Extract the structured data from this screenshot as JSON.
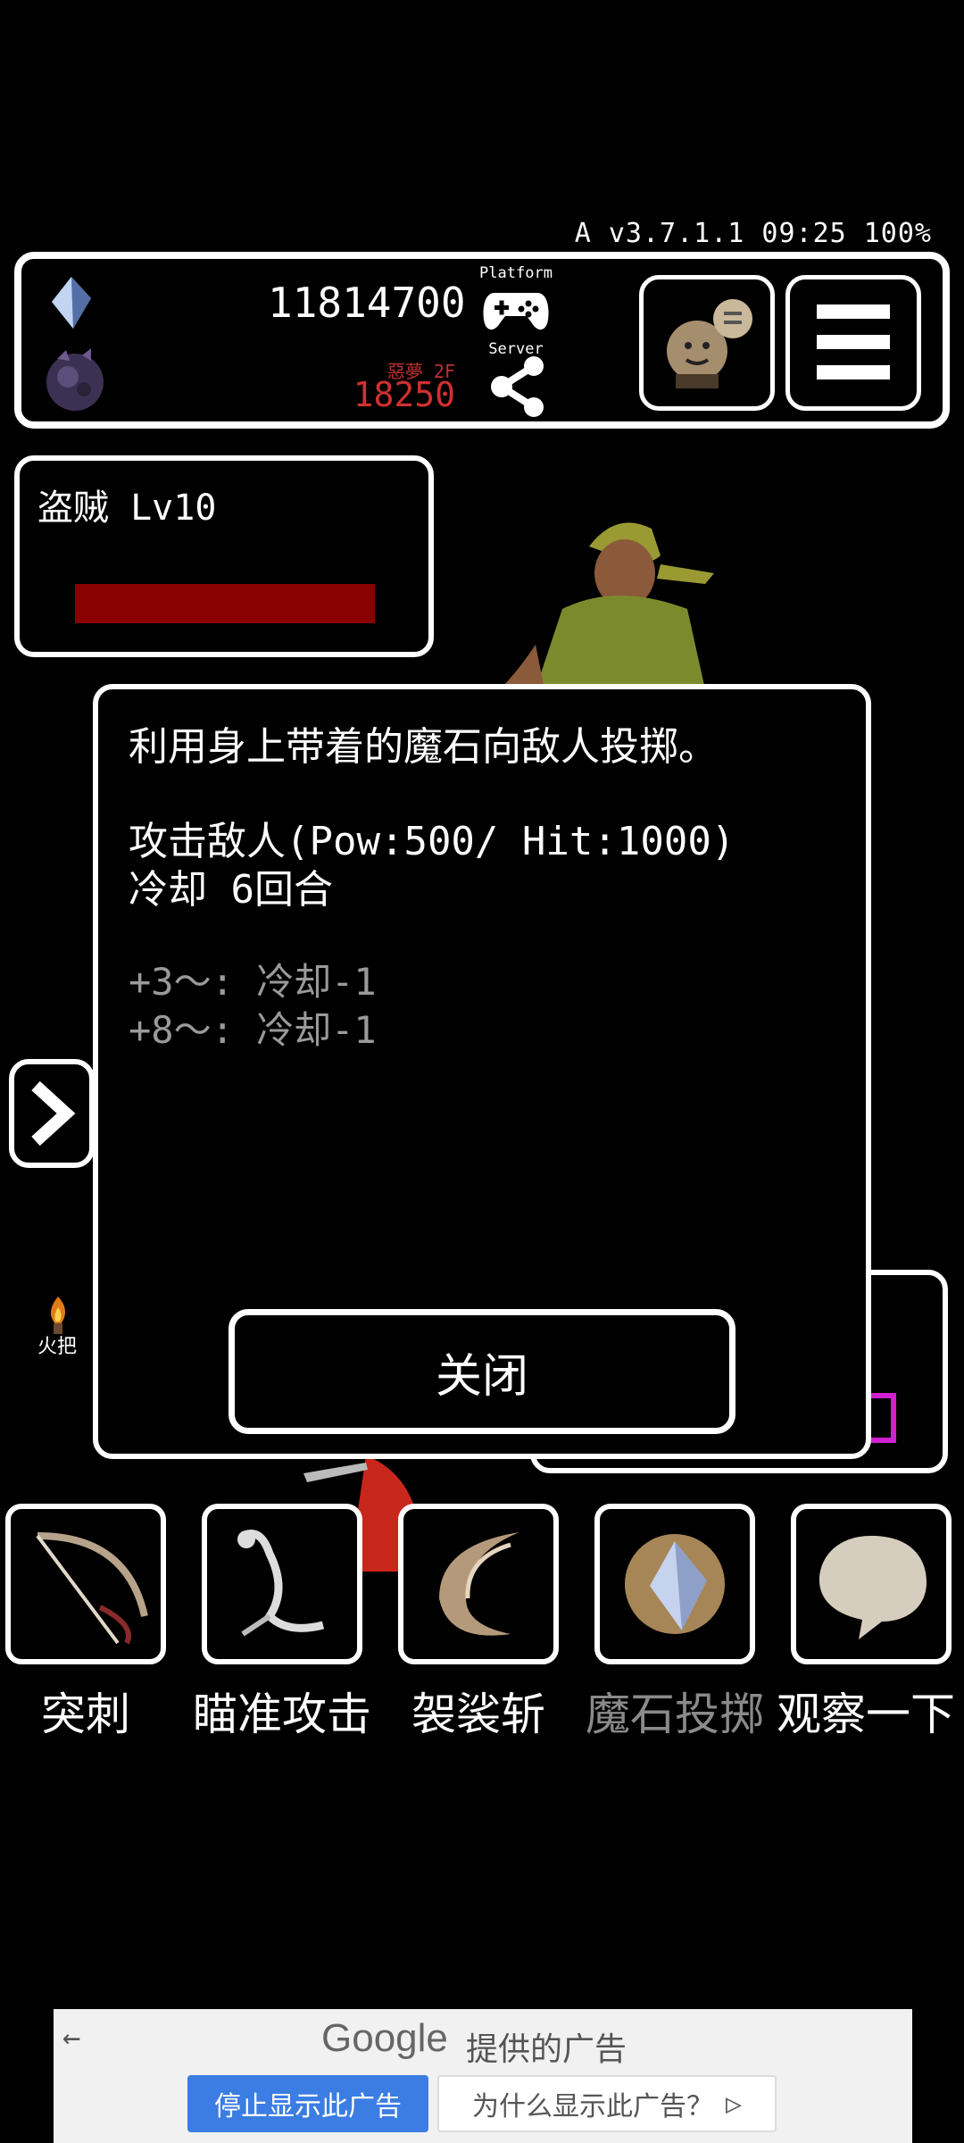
{
  "status": {
    "text": "A v3.7.1.1 09:25 100%"
  },
  "topbar": {
    "gold": "11814700",
    "floor": "惡夢 2F",
    "points": "18250",
    "platform_label": "Platform",
    "server_label": "Server"
  },
  "enemy": {
    "name": "盗贼 Lv10",
    "hp_fraction": 1.0
  },
  "dialog": {
    "description": "利用身上带着的魔石向敌人投掷。",
    "attack": "攻击敌人(Pow:500/ Hit:1000)",
    "cooldown": "冷却 6回合",
    "bonus1": "+3～: 冷却-1",
    "bonus2": "+8～: 冷却-1",
    "close_label": "关闭"
  },
  "side": {
    "torch_label": "火把"
  },
  "skills": [
    {
      "label": "突刺",
      "icon": "bow-icon",
      "enabled": true
    },
    {
      "label": "瞄准攻击",
      "icon": "scorpion-icon",
      "enabled": true
    },
    {
      "label": "袈裟斩",
      "icon": "slash-icon",
      "enabled": true
    },
    {
      "label": "魔石投掷",
      "icon": "magic-stone-icon",
      "enabled": false
    },
    {
      "label": "观察一下",
      "icon": "speech-bubble-icon",
      "enabled": true
    }
  ],
  "ad": {
    "google": "Google",
    "by": "提供的广告",
    "stop": "停止显示此广告",
    "why": "为什么显示此广告？"
  },
  "colors": {
    "hp": "#8b0000",
    "points": "#d03030",
    "ad_button": "#3b7de2",
    "disabled_text": "#9a9a9a"
  }
}
